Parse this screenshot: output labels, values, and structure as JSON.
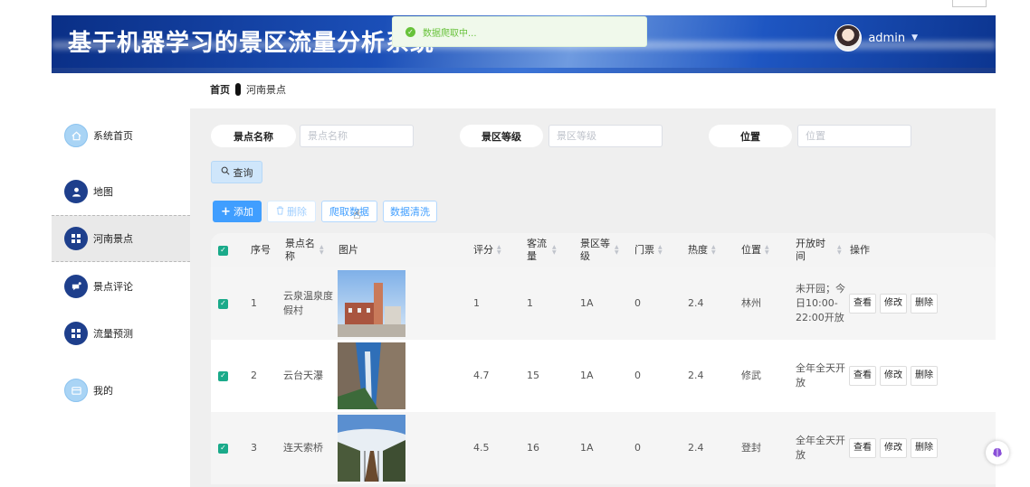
{
  "header": {
    "title": "基于机器学习的景区流量分析系统",
    "username": "admin"
  },
  "toast": {
    "message": "数据爬取中..."
  },
  "breadcrumb": {
    "home": "首页",
    "current": "河南景点"
  },
  "sidebar": {
    "items": [
      {
        "label": "系统首页",
        "icon": "home-icon"
      },
      {
        "label": "地图",
        "icon": "user-icon"
      },
      {
        "label": "河南景点",
        "icon": "grid-icon",
        "active": true
      },
      {
        "label": "景点评论",
        "icon": "comment-icon"
      },
      {
        "label": "流量预测",
        "icon": "grid-icon"
      },
      {
        "label": "我的",
        "icon": "card-icon"
      }
    ]
  },
  "search": {
    "name_label": "景点名称",
    "name_placeholder": "景点名称",
    "level_label": "景区等级",
    "level_placeholder": "景区等级",
    "location_label": "位置",
    "location_placeholder": "位置",
    "query_button": "查询"
  },
  "toolbar": {
    "add": "添加",
    "delete": "删除",
    "crawl": "爬取数据",
    "clean": "数据清洗"
  },
  "table": {
    "columns": {
      "index": "序号",
      "name": "景点名称",
      "image": "图片",
      "rating": "评分",
      "visitors": "客流量",
      "level": "景区等级",
      "ticket": "门票",
      "heat": "热度",
      "location": "位置",
      "open_time": "开放时间",
      "actions": "操作"
    },
    "action_labels": {
      "view": "查看",
      "edit": "修改",
      "delete": "删除"
    },
    "rows": [
      {
        "index": "1",
        "name": "云泉温泉度假村",
        "rating": "1",
        "visitors": "1",
        "level": "1A",
        "ticket": "0",
        "heat": "2.4",
        "location": "林州",
        "open_time": "未开园；今日10:00-22:00开放"
      },
      {
        "index": "2",
        "name": "云台天瀑",
        "rating": "4.7",
        "visitors": "15",
        "level": "1A",
        "ticket": "0",
        "heat": "2.4",
        "location": "修武",
        "open_time": "全年全天开放"
      },
      {
        "index": "3",
        "name": "连天索桥",
        "rating": "4.5",
        "visitors": "16",
        "level": "1A",
        "ticket": "0",
        "heat": "2.4",
        "location": "登封",
        "open_time": "全年全天开放"
      }
    ]
  },
  "colors": {
    "primary": "#409eff",
    "header_dark": "#0a2f86",
    "checkbox": "#1aaa8a",
    "toast_text": "#67c23a"
  }
}
